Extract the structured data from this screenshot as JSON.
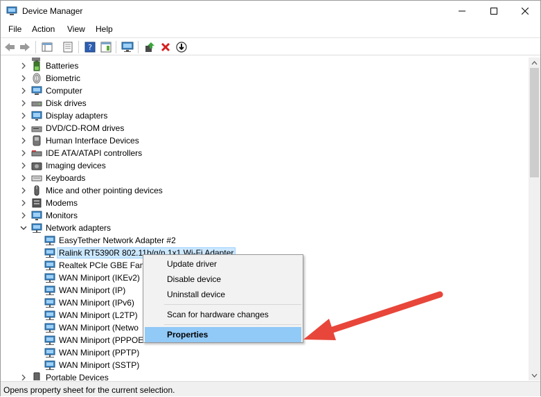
{
  "window": {
    "title": "Device Manager"
  },
  "menu": [
    "File",
    "Action",
    "View",
    "Help"
  ],
  "toolbar": {
    "buttons": [
      "back-icon",
      "forward-icon",
      "properties-sheet-icon",
      "device-list-icon",
      "help-icon",
      "action-pane-icon",
      "computer-monitor-icon",
      "update-driver-icon",
      "uninstall-icon",
      "download-icon"
    ]
  },
  "tree": {
    "categories": [
      {
        "label": "Batteries",
        "icon": "battery-icon"
      },
      {
        "label": "Biometric",
        "icon": "fingerprint-icon"
      },
      {
        "label": "Computer",
        "icon": "computer-icon"
      },
      {
        "label": "Disk drives",
        "icon": "disk-drive-icon"
      },
      {
        "label": "Display adapters",
        "icon": "display-adapter-icon"
      },
      {
        "label": "DVD/CD-ROM drives",
        "icon": "dvd-drive-icon"
      },
      {
        "label": "Human Interface Devices",
        "icon": "hid-icon"
      },
      {
        "label": "IDE ATA/ATAPI controllers",
        "icon": "ide-controller-icon"
      },
      {
        "label": "Imaging devices",
        "icon": "camera-icon"
      },
      {
        "label": "Keyboards",
        "icon": "keyboard-icon"
      },
      {
        "label": "Mice and other pointing devices",
        "icon": "mouse-icon"
      },
      {
        "label": "Modems",
        "icon": "modem-icon"
      },
      {
        "label": "Monitors",
        "icon": "monitor-icon"
      },
      {
        "label": "Network adapters",
        "icon": "network-adapter-icon"
      }
    ],
    "network_adapters": [
      "EasyTether Network Adapter #2",
      "Ralink RT5390R 802.11b/g/n 1x1 Wi-Fi Adapter",
      "Realtek PCIe GBE Famil",
      "WAN Miniport (IKEv2)",
      "WAN Miniport (IP)",
      "WAN Miniport (IPv6)",
      "WAN Miniport (L2TP)",
      "WAN Miniport (Netwo",
      "WAN Miniport (PPPOE",
      "WAN Miniport (PPTP)",
      "WAN Miniport (SSTP)"
    ],
    "after": "Portable Devices"
  },
  "context_menu": {
    "items": [
      "Update driver",
      "Disable device",
      "Uninstall device",
      "Scan for hardware changes",
      "Properties"
    ]
  },
  "status": {
    "text": "Opens property sheet for the current selection."
  },
  "colors": {
    "selection": "#cce8ff",
    "menu_highlight": "#91c9f7",
    "arrow": "#e8463a"
  }
}
